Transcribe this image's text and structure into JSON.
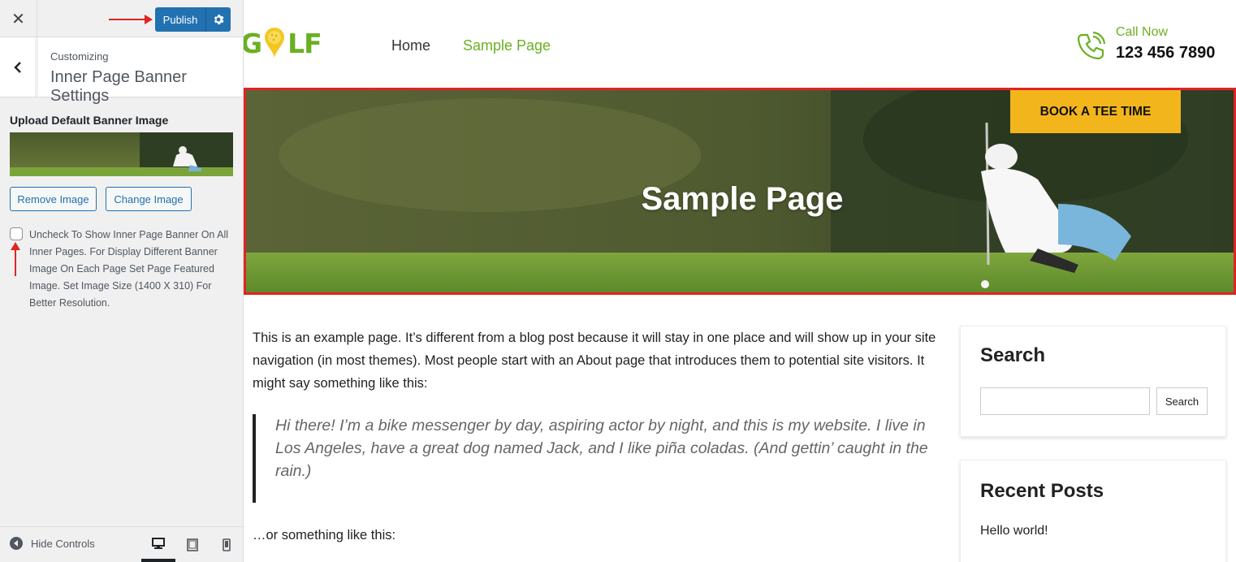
{
  "sidebar": {
    "close_glyph": "✕",
    "publish_label": "Publish",
    "section": {
      "customizing": "Customizing",
      "title": "Inner Page Banner Settings"
    },
    "control": {
      "title": "Upload Default Banner Image",
      "remove_label": "Remove Image",
      "change_label": "Change Image",
      "checkbox_checked": false,
      "checkbox_text": "Uncheck To Show Inner Page Banner On All Inner Pages. For Display Different Banner Image On Each Page Set Page Featured Image. Set Image Size (1400 X 310) For Better Resolution."
    },
    "footer": {
      "hide_controls": "Hide Controls",
      "devices": [
        "desktop-icon",
        "tablet-icon",
        "mobile-icon"
      ],
      "active_device": "desktop"
    },
    "annotation_color": "#e02424"
  },
  "preview": {
    "logo_text_left": "G",
    "logo_text_right": "LF",
    "nav": {
      "home": "Home",
      "sample": "Sample Page"
    },
    "contact": {
      "call_label": "Call Now",
      "number": "123 456 7890"
    },
    "banner": {
      "title": "Sample Page",
      "cta": "BOOK A TEE TIME"
    },
    "content": {
      "intro": "This is an example page. It’s different from a blog post because it will stay in one place and will show up in your site navigation (in most themes). Most people start with an About page that introduces them to potential site visitors. It might say something like this:",
      "quote": "Hi there! I’m a bike messenger by day, aspiring actor by night, and this is my website. I live in Los Angeles, have a great dog named Jack, and I like piña coladas. (And gettin’ caught in the rain.)",
      "after_quote": "…or something like this:"
    },
    "widgets": {
      "search_title": "Search",
      "search_button": "Search",
      "search_value": "",
      "recent_title": "Recent Posts",
      "recent_items": [
        "Hello world!"
      ]
    },
    "colors": {
      "brand_green": "#6ab023",
      "cta_yellow": "#f2b51c",
      "wp_blue": "#2271b1"
    }
  }
}
